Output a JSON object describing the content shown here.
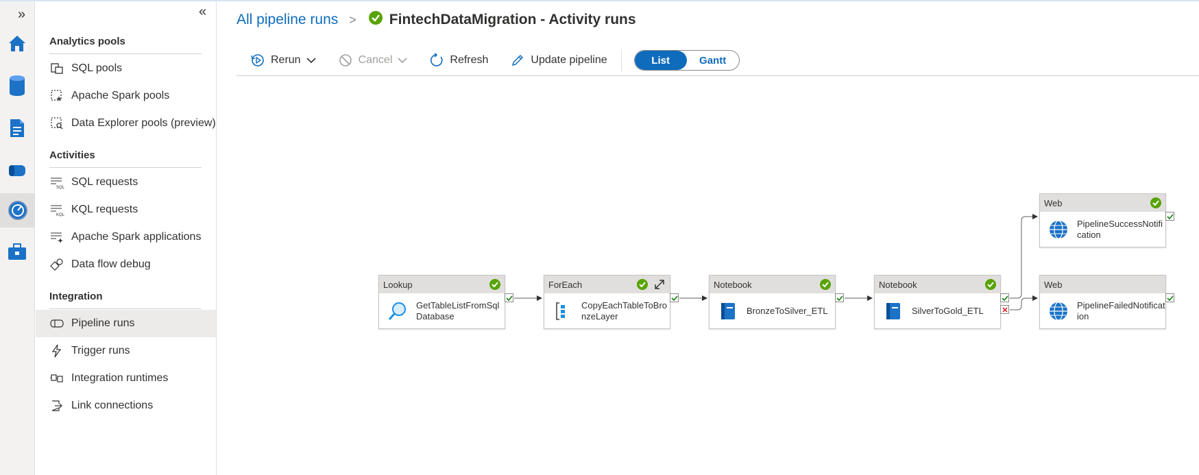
{
  "rail": {
    "expand_icon": "double-chevron-right",
    "items": [
      {
        "name": "home",
        "icon": "home-icon"
      },
      {
        "name": "data",
        "icon": "database-icon"
      },
      {
        "name": "develop",
        "icon": "document-icon"
      },
      {
        "name": "integrate",
        "icon": "pipeline-icon"
      },
      {
        "name": "monitor",
        "icon": "gauge-icon",
        "active": true
      },
      {
        "name": "manage",
        "icon": "toolbox-icon"
      }
    ]
  },
  "sidebar": {
    "collapse_icon": "double-chevron-left",
    "sections": [
      {
        "title": "Analytics pools",
        "items": [
          {
            "label": "SQL pools",
            "icon": "sql-pools-icon"
          },
          {
            "label": "Apache Spark pools",
            "icon": "spark-pools-icon"
          },
          {
            "label": "Data Explorer pools (preview)",
            "icon": "data-explorer-pools-icon"
          }
        ]
      },
      {
        "title": "Activities",
        "items": [
          {
            "label": "SQL requests",
            "icon": "sql-requests-icon"
          },
          {
            "label": "KQL requests",
            "icon": "kql-requests-icon"
          },
          {
            "label": "Apache Spark applications",
            "icon": "spark-applications-icon"
          },
          {
            "label": "Data flow debug",
            "icon": "data-flow-debug-icon"
          }
        ]
      },
      {
        "title": "Integration",
        "items": [
          {
            "label": "Pipeline runs",
            "icon": "pipeline-runs-icon",
            "selected": true
          },
          {
            "label": "Trigger runs",
            "icon": "trigger-runs-icon"
          },
          {
            "label": "Integration runtimes",
            "icon": "integration-runtimes-icon"
          },
          {
            "label": "Link connections",
            "icon": "link-connections-icon"
          }
        ]
      }
    ]
  },
  "breadcrumb": {
    "parent": "All pipeline runs",
    "separator": ">",
    "title": "FintechDataMigration - Activity runs",
    "status": "succeeded"
  },
  "toolbar": {
    "rerun": "Rerun",
    "cancel": "Cancel",
    "refresh": "Refresh",
    "update_pipeline": "Update pipeline",
    "view_toggle": {
      "list": "List",
      "gantt": "Gantt",
      "selected": "List"
    }
  },
  "activities": [
    {
      "id": "lookup",
      "type": "Lookup",
      "name": "GetTableListFromSqlDatabase",
      "status": "succeeded",
      "icon": "lookup-magnifier-icon"
    },
    {
      "id": "foreach",
      "type": "ForEach",
      "name": "CopyEachTableToBronzeLayer",
      "status": "succeeded",
      "icon": "foreach-icon",
      "expandable": true
    },
    {
      "id": "nb1",
      "type": "Notebook",
      "name": "BronzeToSilver_ETL",
      "status": "succeeded",
      "icon": "notebook-icon"
    },
    {
      "id": "nb2",
      "type": "Notebook",
      "name": "SilverToGold_ETL",
      "status": "succeeded",
      "icon": "notebook-icon"
    },
    {
      "id": "web1",
      "type": "Web",
      "name": "PipelineSuccessNotification",
      "status": "succeeded",
      "icon": "globe-icon"
    },
    {
      "id": "web2",
      "type": "Web",
      "name": "PipelineFailedNotification",
      "status": "none",
      "icon": "globe-icon"
    }
  ],
  "colors": {
    "accent": "#0f6cbd",
    "success": "#57a300",
    "failure": "#d13438",
    "port_success": "#107c10"
  }
}
